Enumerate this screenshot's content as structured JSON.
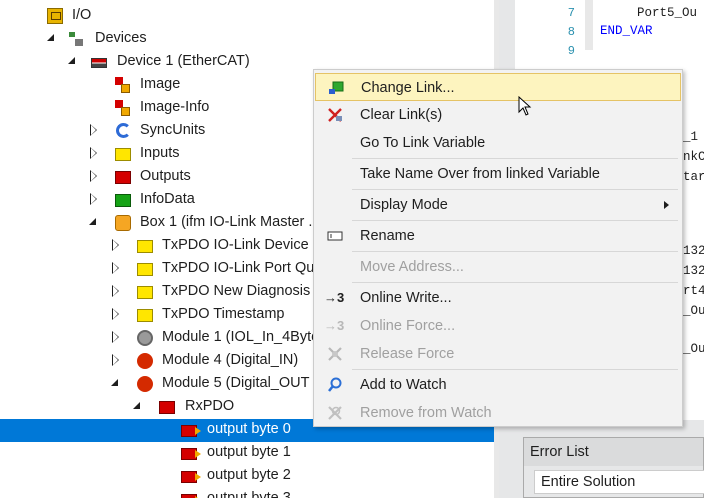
{
  "tree": {
    "rows": [
      {
        "label": "I/O"
      },
      {
        "label": "Devices"
      },
      {
        "label": "Device 1 (EtherCAT)"
      },
      {
        "label": "Image"
      },
      {
        "label": "Image-Info"
      },
      {
        "label": "SyncUnits"
      },
      {
        "label": "Inputs"
      },
      {
        "label": "Outputs"
      },
      {
        "label": "InfoData"
      },
      {
        "label": "Box 1 (ifm IO-Link Master ..."
      },
      {
        "label": "TxPDO IO-Link Device S"
      },
      {
        "label": "TxPDO IO-Link Port Qua"
      },
      {
        "label": "TxPDO New Diagnosis"
      },
      {
        "label": "TxPDO Timestamp"
      },
      {
        "label": "Module 1 (IOL_In_4Byte"
      },
      {
        "label": "Module 4 (Digital_IN)"
      },
      {
        "label": "Module 5 (Digital_OUT"
      },
      {
        "label": "RxPDO"
      },
      {
        "label": "output byte 0"
      },
      {
        "label": "output byte 1"
      },
      {
        "label": "output byte 2"
      },
      {
        "label": "output byte 3"
      }
    ]
  },
  "editor": {
    "line_numbers": [
      "7",
      "8",
      "9"
    ],
    "code_lines": [
      "Port5_Ou",
      "END_VAR"
    ],
    "fragments": [
      "_1",
      "nkC",
      "tar",
      "132",
      "132",
      "rt4",
      "_Ou",
      "_Ou"
    ]
  },
  "error_list": {
    "title": "Error List",
    "scope": "Entire Solution"
  },
  "context_menu": {
    "items": [
      {
        "label": "Change Link...",
        "icon": "link-green-icon"
      },
      {
        "label": "Clear Link(s)",
        "icon": "clear-link-icon"
      },
      {
        "label": "Go To Link Variable"
      },
      {
        "label": "Take Name Over from linked Variable"
      },
      {
        "label": "Display Mode"
      },
      {
        "label": "Rename",
        "icon": "rename-icon"
      },
      {
        "label": "Move Address...",
        "disabled": true
      },
      {
        "label": "Online Write...",
        "icon": "online-write-icon"
      },
      {
        "label": "Online Force...",
        "icon": "online-force-icon",
        "disabled": true
      },
      {
        "label": "Release Force",
        "icon": "release-force-icon",
        "disabled": true
      },
      {
        "label": "Add to Watch",
        "icon": "add-watch-icon"
      },
      {
        "label": "Remove from Watch",
        "icon": "remove-watch-icon",
        "disabled": true
      }
    ],
    "online_write_glyph": "→3",
    "online_force_glyph": "→3"
  },
  "colors": {
    "selection": "#0078d7",
    "menu_highlight": "#fdf4bf",
    "menu_highlight_border": "#e5c365"
  }
}
